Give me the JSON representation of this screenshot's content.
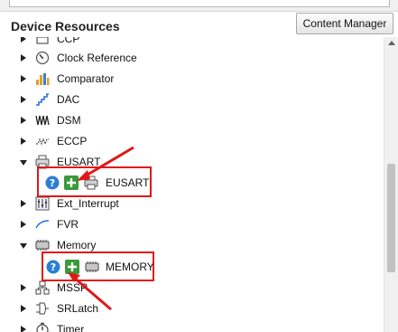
{
  "panel": {
    "title": "Device Resources",
    "content_manager_label": "Content Manager"
  },
  "tree": {
    "items": [
      {
        "label": "CCP",
        "icon": "ccp-icon",
        "expanded": false
      },
      {
        "label": "Clock Reference",
        "icon": "clock-icon",
        "expanded": false
      },
      {
        "label": "Comparator",
        "icon": "comparator-icon",
        "expanded": false
      },
      {
        "label": "DAC",
        "icon": "dac-icon",
        "expanded": false
      },
      {
        "label": "DSM",
        "icon": "dsm-icon",
        "expanded": false
      },
      {
        "label": "ECCP",
        "icon": "eccp-icon",
        "expanded": false
      },
      {
        "label": "EUSART",
        "icon": "eusart-icon",
        "expanded": true,
        "child": {
          "label": "EUSART",
          "help_icon": "help-icon",
          "add_icon": "add-icon",
          "module_icon": "printer-icon"
        }
      },
      {
        "label": "Ext_Interrupt",
        "icon": "ext-interrupt-icon",
        "expanded": false
      },
      {
        "label": "FVR",
        "icon": "fvr-icon",
        "expanded": false
      },
      {
        "label": "Memory",
        "icon": "memory-icon",
        "expanded": true,
        "child": {
          "label": "MEMORY",
          "help_icon": "help-icon",
          "add_icon": "add-icon",
          "module_icon": "memory-chip-icon"
        }
      },
      {
        "label": "MSSP",
        "icon": "mssp-icon",
        "expanded": false
      },
      {
        "label": "SRLatch",
        "icon": "srlatch-icon",
        "expanded": false
      },
      {
        "label": "Timer",
        "icon": "timer-icon",
        "expanded": false
      }
    ]
  },
  "colors": {
    "highlight": "#e01818",
    "help_blue": "#2a7fd4",
    "add_green": "#3a9a3a"
  }
}
